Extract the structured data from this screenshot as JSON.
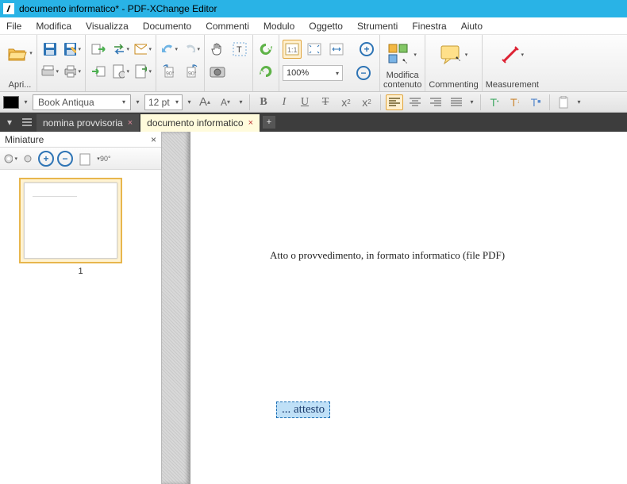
{
  "window": {
    "title": "documento informatico* - PDF-XChange Editor"
  },
  "menu": {
    "file": "File",
    "edit": "Modifica",
    "view": "Visualizza",
    "document": "Documento",
    "comments": "Commenti",
    "module": "Modulo",
    "object": "Oggetto",
    "tools": "Strumenti",
    "window": "Finestra",
    "help": "Aiuto"
  },
  "toolbar": {
    "open_label": "Apri...",
    "zoom_value": "100%",
    "modify_content": "Modifica\ncontenuto",
    "commenting": "Commenting",
    "measurement": "Measurement"
  },
  "formatbar": {
    "font": "Book Antiqua",
    "size": "12 pt",
    "grow": "A",
    "shrink": "A",
    "bold": "B",
    "italic": "I",
    "underline": "U",
    "strike": "T",
    "sub": "x",
    "sup": "x",
    "t1": "T",
    "t2": "T",
    "t3": "T"
  },
  "tabs": {
    "tab1": "nomina provvisoria",
    "tab2": "documento informatico"
  },
  "thumbs": {
    "title": "Miniature",
    "page1_label": "1",
    "rotate_deg": "90°"
  },
  "document": {
    "body_line": "Atto o provvedimento, in formato informatico (file PDF)",
    "attesto": "... attesto"
  }
}
